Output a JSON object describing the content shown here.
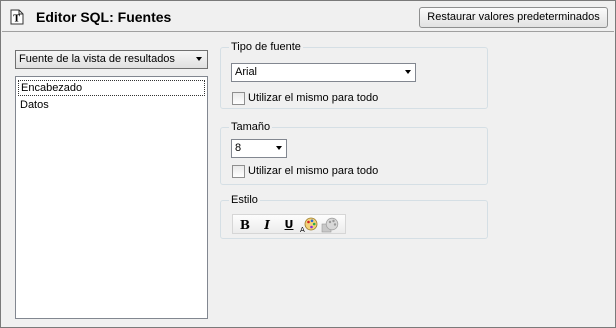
{
  "header": {
    "title": "Editor SQL: Fuentes",
    "restore_button": "Restaurar valores predeterminados"
  },
  "source": {
    "selected": "Fuente de la vista de resultados"
  },
  "list": {
    "items": [
      "Encabezado",
      "Datos"
    ]
  },
  "font_type": {
    "legend": "Tipo de fuente",
    "value": "Arial",
    "same_for_all": "Utilizar el mismo para todo"
  },
  "size": {
    "legend": "Tamaño",
    "value": "8",
    "same_for_all": "Utilizar el mismo para todo"
  },
  "style": {
    "legend": "Estilo",
    "bold": "B",
    "italic": "I",
    "underline": "U"
  }
}
